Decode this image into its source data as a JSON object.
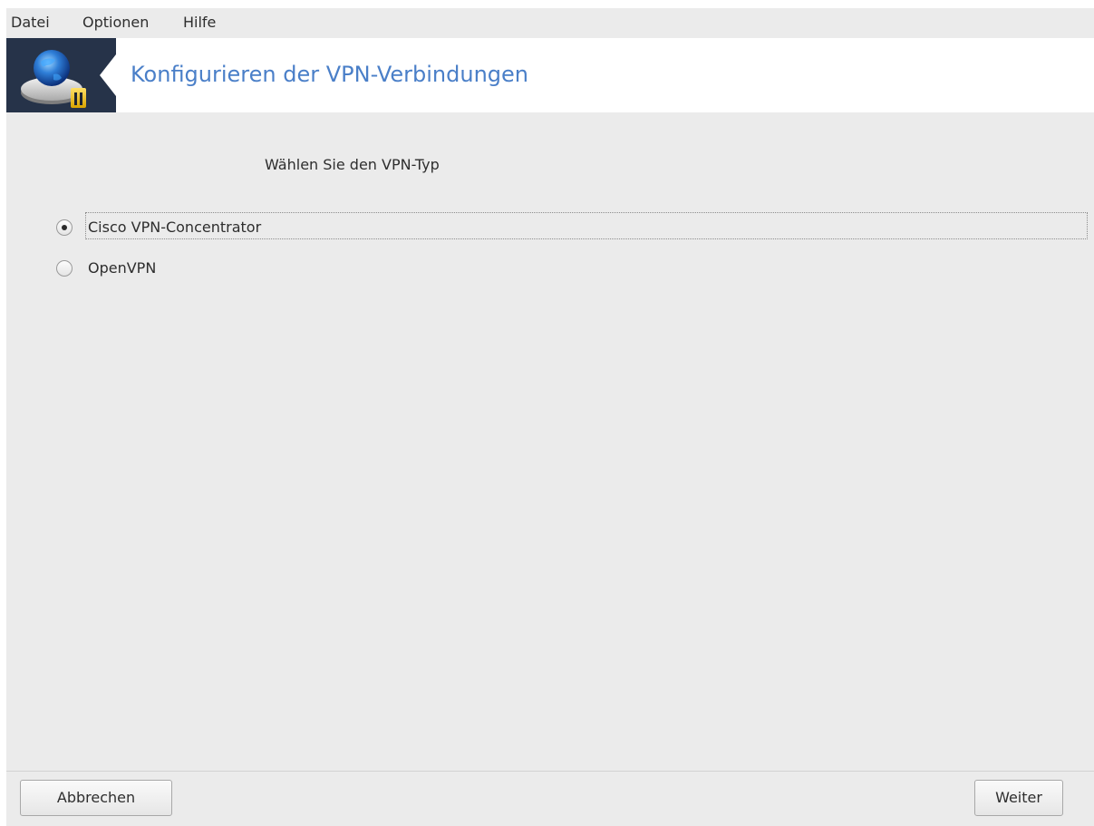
{
  "menubar": {
    "items": [
      {
        "label": "Datei"
      },
      {
        "label": "Optionen"
      },
      {
        "label": "Hilfe"
      }
    ]
  },
  "banner": {
    "title": "Konfigurieren der VPN-Verbindungen",
    "icon": "vpn-network-globe-lock-icon",
    "title_color": "#4a7fc8",
    "dark_color": "#263349"
  },
  "main": {
    "instruction": "Wählen Sie den VPN-Typ",
    "options": [
      {
        "label": "Cisco VPN-Concentrator",
        "selected": true
      },
      {
        "label": "OpenVPN",
        "selected": false
      }
    ]
  },
  "footer": {
    "cancel_label": "Abbrechen",
    "next_label": "Weiter"
  }
}
